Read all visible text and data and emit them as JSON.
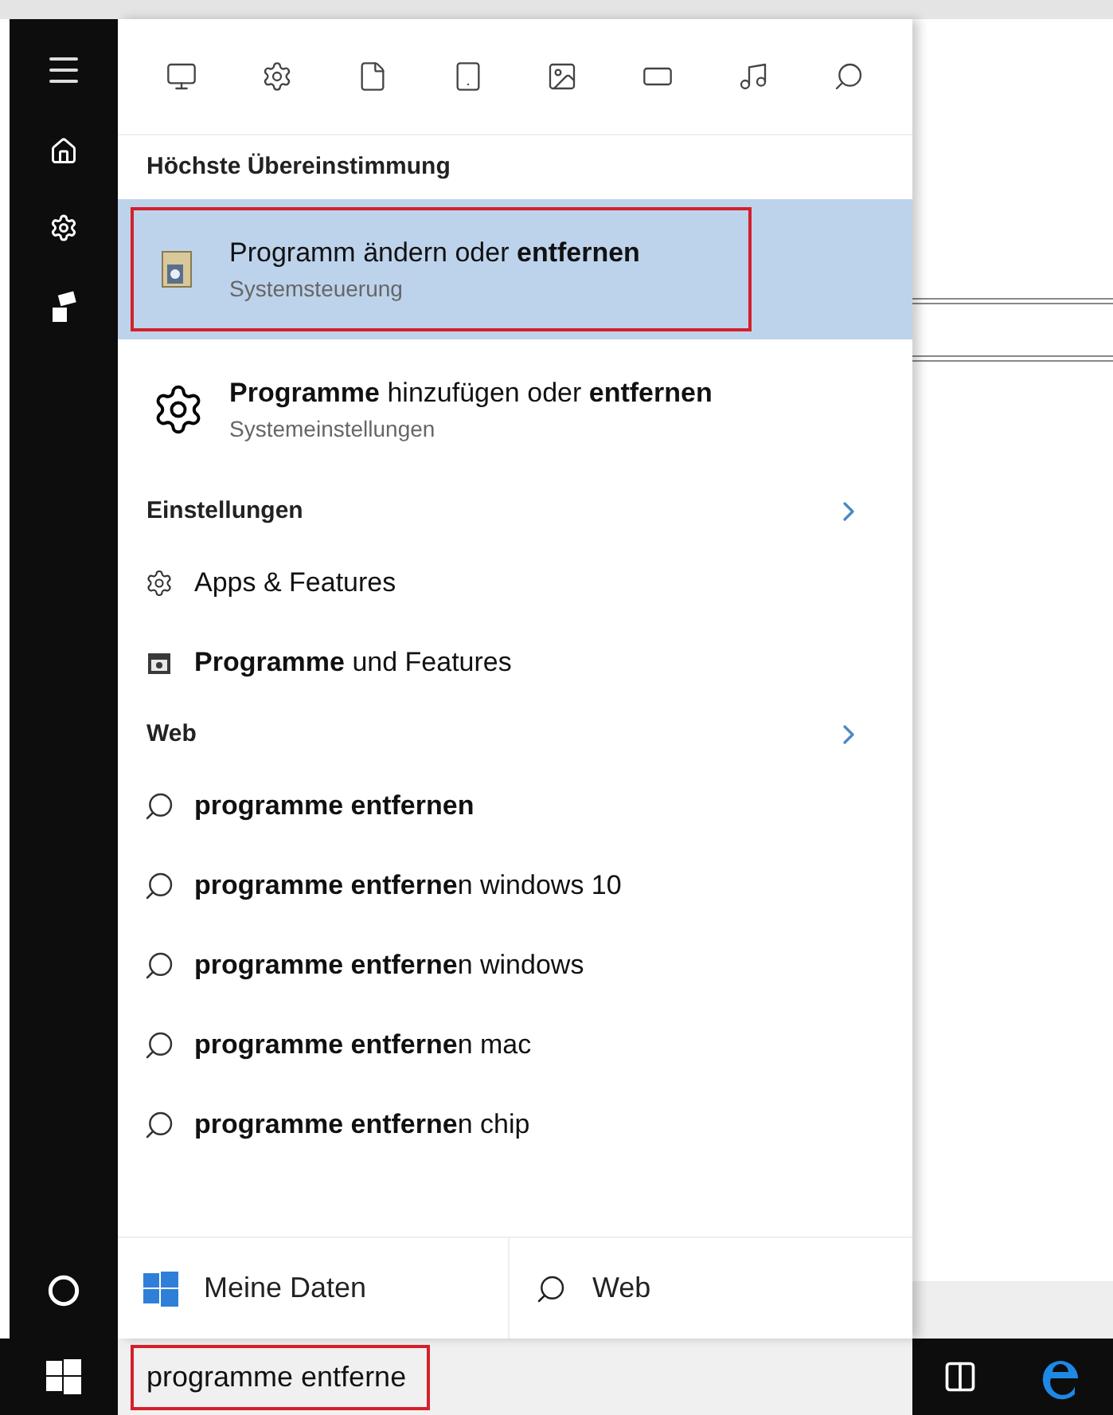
{
  "sections": [
    {
      "heading": "Höchste Übereinstimmung",
      "items": [
        {
          "kind": "app",
          "title": "Programm ändern oder **entfernen**",
          "subtitle": "Systemsteuerung",
          "selected": true
        },
        {
          "kind": "settings",
          "title": "**Programme** hinzufügen oder **entfernen**",
          "subtitle": "Systemeinstellungen",
          "selected": false
        }
      ]
    },
    {
      "heading": "Einstellungen",
      "has_more": true,
      "items": [
        {
          "kind": "gear",
          "title": "Apps & Features",
          "selected": false
        },
        {
          "kind": "panel",
          "title": "**Programme** und Features",
          "selected": false
        }
      ]
    },
    {
      "heading": "Web",
      "has_more": true,
      "items": [
        {
          "kind": "web",
          "title": "**programme entfernen**",
          "selected": false
        },
        {
          "kind": "web",
          "title": "**programme entferne**n windows 10",
          "selected": false
        },
        {
          "kind": "web",
          "title": "**programme entferne**n windows",
          "selected": false
        },
        {
          "kind": "web",
          "title": "**programme entferne**n mac",
          "selected": false
        },
        {
          "kind": "web",
          "title": "**programme entferne**n chip",
          "selected": false
        }
      ]
    }
  ],
  "scopes": [
    "Meine Daten",
    "Web"
  ],
  "search": {
    "value": "programme entferne"
  }
}
